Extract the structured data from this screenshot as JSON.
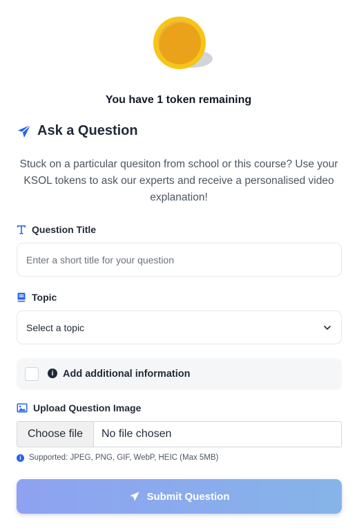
{
  "token_status": "You have 1 token remaining",
  "header": {
    "title": "Ask a Question",
    "icon": "paper-plane-icon"
  },
  "description": "Stuck on a particular quesiton from school or this course? Use your KSOL tokens to ask our experts and receive a personalised video explanation!",
  "question_title": {
    "label": "Question Title",
    "icon": "text-t-icon",
    "placeholder": "Enter a short title for your question",
    "value": ""
  },
  "topic": {
    "label": "Topic",
    "icon": "book-icon",
    "selected": "Select a topic"
  },
  "additional_info": {
    "label": "Add additional information",
    "checked": false
  },
  "upload": {
    "label": "Upload Question Image",
    "icon": "image-icon",
    "button_label": "Choose file",
    "status": "No file chosen",
    "hint": "Supported: JPEG, PNG, GIF, WebP, HEIC (Max 5MB)"
  },
  "submit": {
    "label": "Submit Question"
  },
  "colors": {
    "accent": "#2563eb",
    "coin_outer": "#f5c518",
    "coin_inner": "#eaa21a",
    "submit_start": "#8ea2f1",
    "submit_end": "#86b4e8"
  }
}
